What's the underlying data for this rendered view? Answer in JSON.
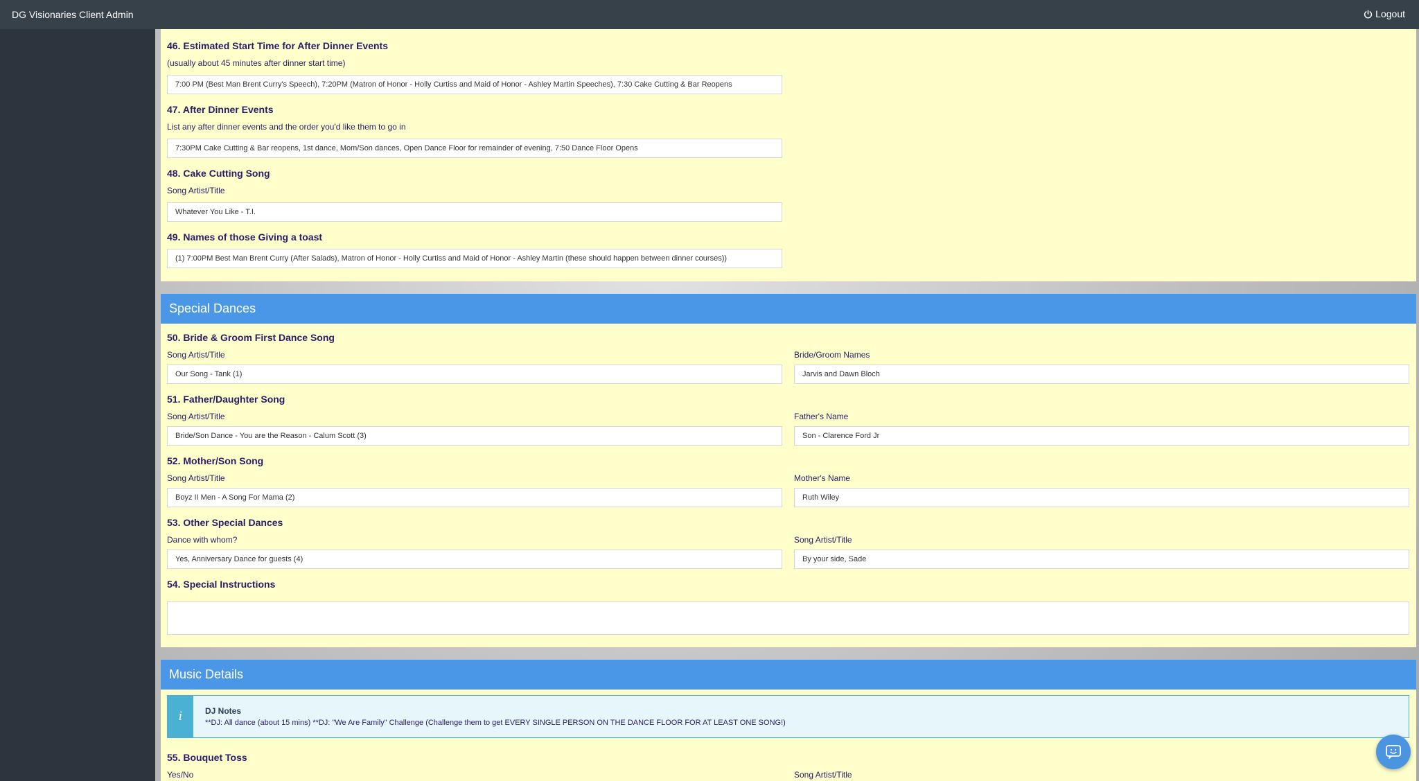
{
  "header": {
    "app_title": "DG Visionaries Client Admin",
    "logout_label": "Logout"
  },
  "events": {
    "q46": {
      "title": "46. Estimated Start Time for After Dinner Events",
      "subtitle": "(usually about 45 minutes after dinner start time)",
      "value": "7:00 PM (Best Man Brent Curry's Speech), 7:20PM (Matron of Honor - Holly Curtiss and Maid of Honor - Ashley Martin Speeches), 7:30 Cake Cutting & Bar Reopens"
    },
    "q47": {
      "title": "47. After Dinner Events",
      "subtitle": "List any after dinner events and the order you'd like them to go in",
      "value": "7:30PM Cake Cutting & Bar reopens, 1st dance, Mom/Son dances, Open Dance Floor for remainder of evening, 7:50 Dance Floor Opens"
    },
    "q48": {
      "title": "48. Cake Cutting Song",
      "subtitle": "Song Artist/Title",
      "value": "Whatever You Like - T.I."
    },
    "q49": {
      "title": "49. Names of those Giving a toast",
      "value": "(1) 7:00PM Best Man Brent Curry (After Salads), Matron of Honor - Holly Curtiss and Maid of Honor - Ashley Martin (these should happen between dinner courses))"
    }
  },
  "special_dances": {
    "header": "Special Dances",
    "q50": {
      "title": "50. Bride & Groom First Dance Song",
      "left_label": "Song Artist/Title",
      "left_value": "Our Song - Tank (1)",
      "right_label": "Bride/Groom Names",
      "right_value": "Jarvis and Dawn Bloch"
    },
    "q51": {
      "title": "51. Father/Daughter Song",
      "left_label": "Song Artist/Title",
      "left_value": "Bride/Son Dance - You are the Reason - Calum Scott (3)",
      "right_label": "Father's Name",
      "right_value": "Son - Clarence Ford Jr"
    },
    "q52": {
      "title": "52. Mother/Son Song",
      "left_label": "Song Artist/Title",
      "left_value": "Boyz II Men - A Song For Mama (2)",
      "right_label": "Mother's Name",
      "right_value": "Ruth Wiley"
    },
    "q53": {
      "title": "53. Other Special Dances",
      "left_label": "Dance with whom?",
      "left_value": "Yes, Anniversary Dance for guests (4)",
      "right_label": "Song Artist/Title",
      "right_value": "By your side, Sade"
    },
    "q54": {
      "title": "54. Special Instructions",
      "value": ""
    }
  },
  "music_details": {
    "header": "Music Details",
    "notes_title": "DJ Notes",
    "notes_text": "**DJ: All dance (about 15 mins) **DJ: \"We Are Family\" Challenge (Challenge them to get EVERY SINGLE PERSON ON THE DANCE FLOOR FOR AT LEAST ONE SONG!)",
    "notes_icon": "i",
    "q55": {
      "title": "55. Bouquet Toss",
      "left_label": "Yes/No",
      "right_label": "Song Artist/Title"
    }
  },
  "icons": {
    "logout": "power-icon",
    "chat": "chat-icon",
    "info": "info-icon"
  },
  "colors": {
    "topbar": "#37414a",
    "sidebar": "#2c353e",
    "panel_bg": "#ffffcc",
    "section_header": "#4a97e8",
    "question_text": "#2b1a66"
  }
}
